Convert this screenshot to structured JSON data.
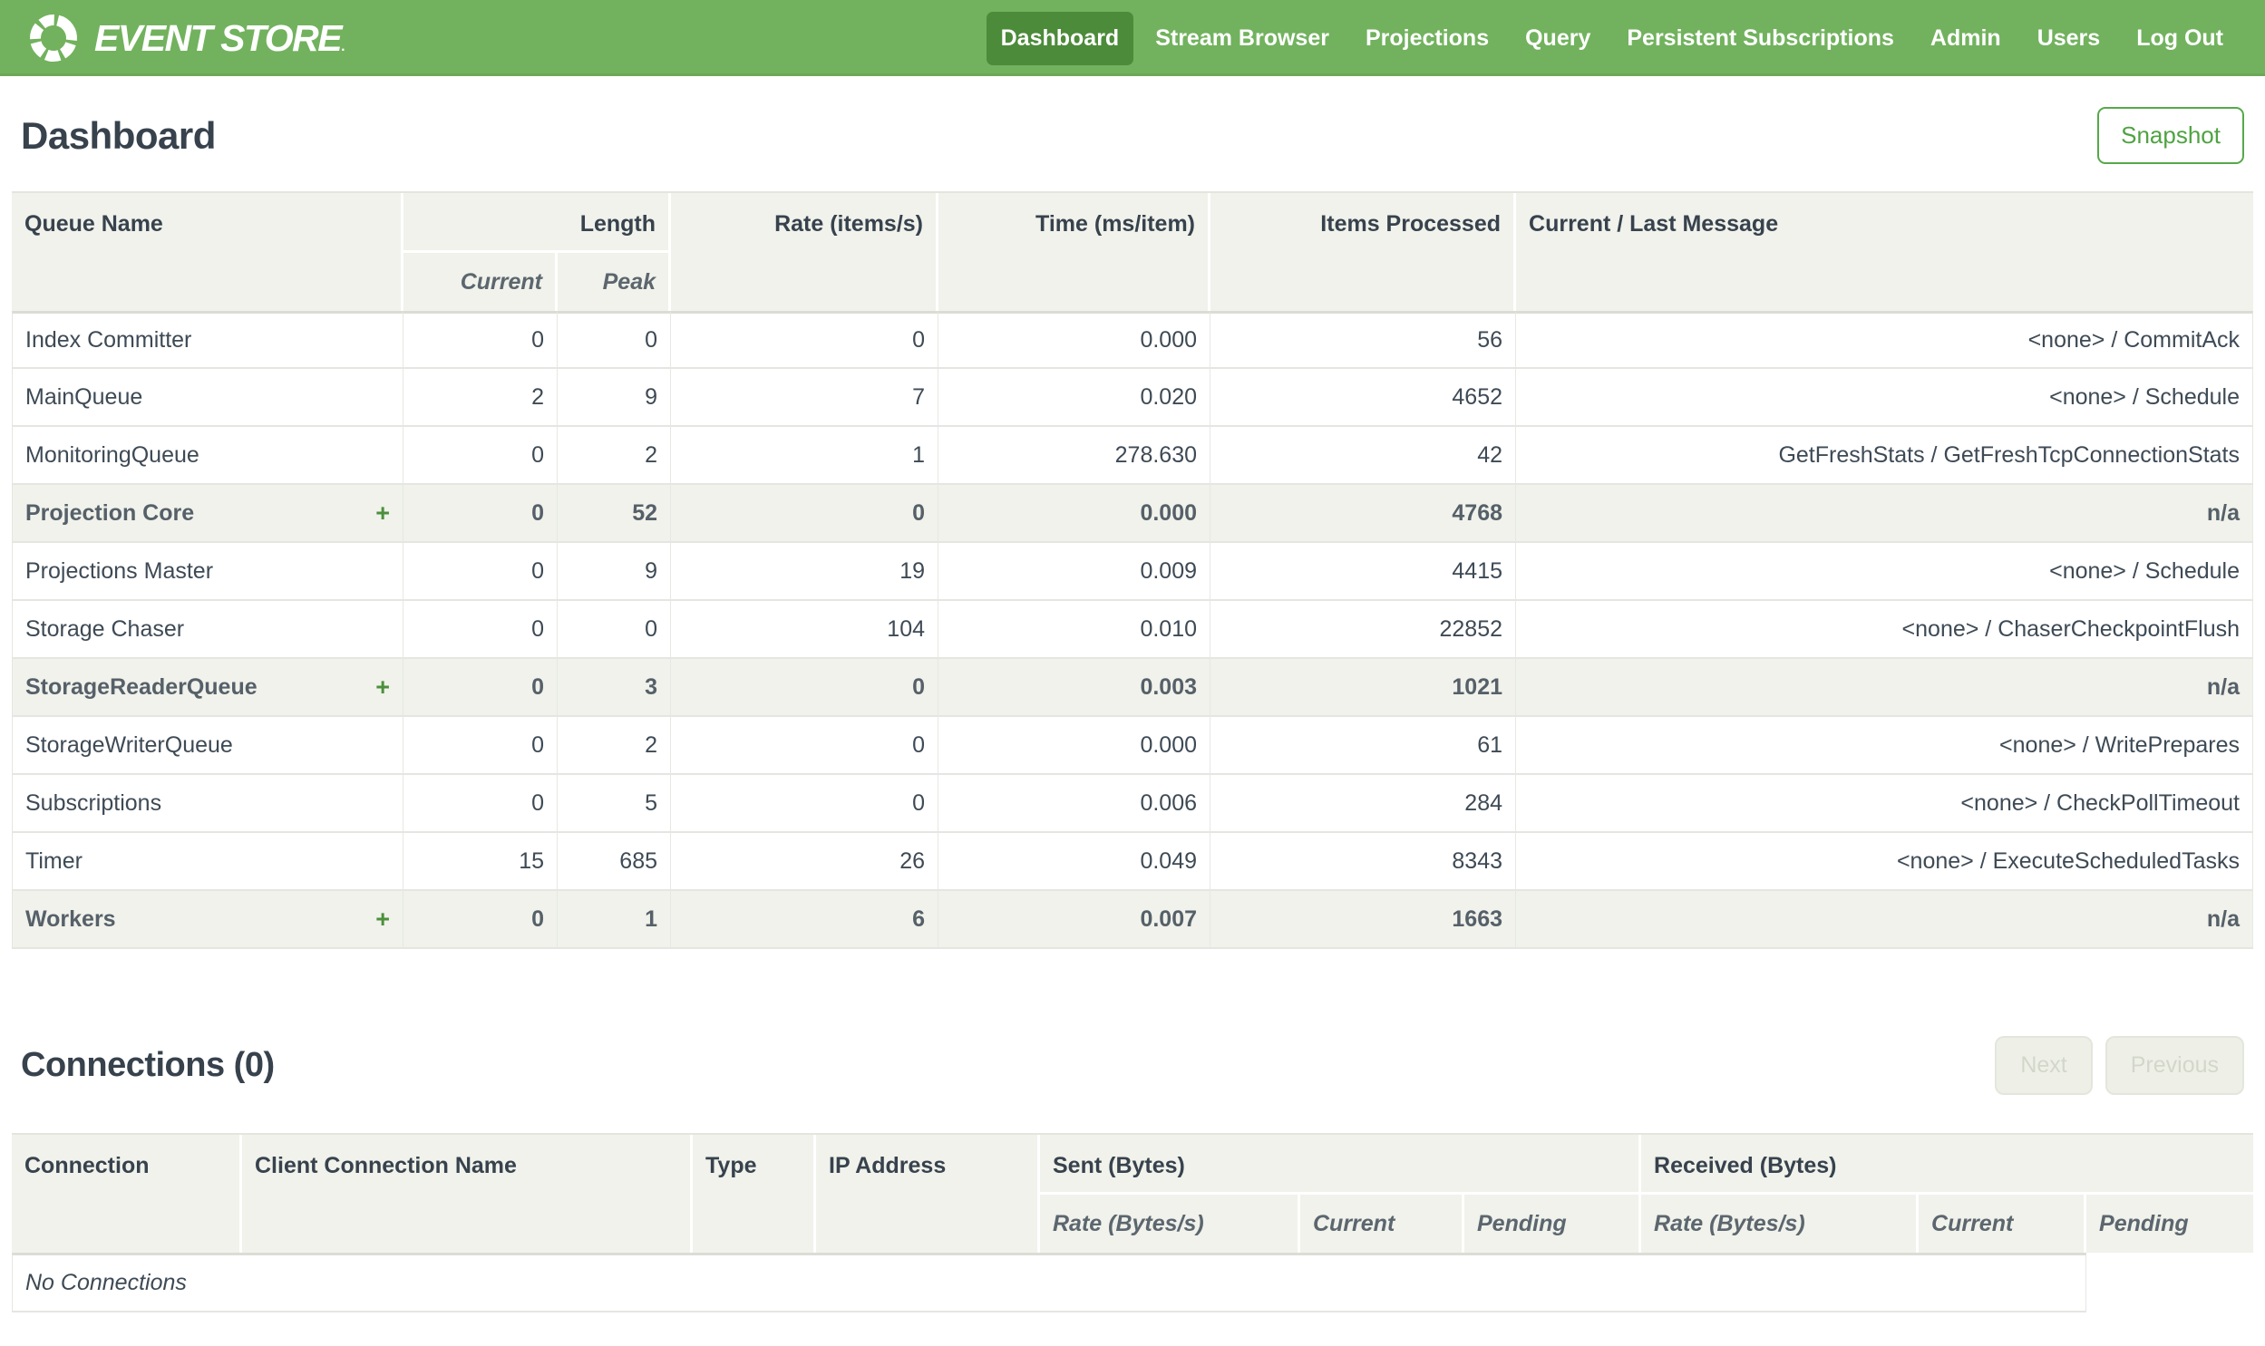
{
  "nav": {
    "brand": "EVENT STORE",
    "brand_mark": ".",
    "items": [
      {
        "label": "Dashboard",
        "active": true
      },
      {
        "label": "Stream Browser",
        "active": false
      },
      {
        "label": "Projections",
        "active": false
      },
      {
        "label": "Query",
        "active": false
      },
      {
        "label": "Persistent Subscriptions",
        "active": false
      },
      {
        "label": "Admin",
        "active": false
      },
      {
        "label": "Users",
        "active": false
      },
      {
        "label": "Log Out",
        "active": false
      }
    ]
  },
  "page": {
    "title": "Dashboard",
    "snapshot_label": "Snapshot"
  },
  "queue_table": {
    "expand_symbol": "+",
    "headers": {
      "queue_name": "Queue Name",
      "length": "Length",
      "current": "Current",
      "peak": "Peak",
      "rate": "Rate (items/s)",
      "time": "Time (ms/item)",
      "items_processed": "Items Processed",
      "message": "Current / Last Message"
    },
    "rows": [
      {
        "name": "Index Committer",
        "group": false,
        "current": "0",
        "peak": "0",
        "rate": "0",
        "time": "0.000",
        "items": "56",
        "message": "<none> / CommitAck"
      },
      {
        "name": "MainQueue",
        "group": false,
        "current": "2",
        "peak": "9",
        "rate": "7",
        "time": "0.020",
        "items": "4652",
        "message": "<none> / Schedule"
      },
      {
        "name": "MonitoringQueue",
        "group": false,
        "current": "0",
        "peak": "2",
        "rate": "1",
        "time": "278.630",
        "items": "42",
        "message": "GetFreshStats / GetFreshTcpConnectionStats"
      },
      {
        "name": "Projection Core",
        "group": true,
        "current": "0",
        "peak": "52",
        "rate": "0",
        "time": "0.000",
        "items": "4768",
        "message": "n/a"
      },
      {
        "name": "Projections Master",
        "group": false,
        "current": "0",
        "peak": "9",
        "rate": "19",
        "time": "0.009",
        "items": "4415",
        "message": "<none> / Schedule"
      },
      {
        "name": "Storage Chaser",
        "group": false,
        "current": "0",
        "peak": "0",
        "rate": "104",
        "time": "0.010",
        "items": "22852",
        "message": "<none> / ChaserCheckpointFlush"
      },
      {
        "name": "StorageReaderQueue",
        "group": true,
        "current": "0",
        "peak": "3",
        "rate": "0",
        "time": "0.003",
        "items": "1021",
        "message": "n/a"
      },
      {
        "name": "StorageWriterQueue",
        "group": false,
        "current": "0",
        "peak": "2",
        "rate": "0",
        "time": "0.000",
        "items": "61",
        "message": "<none> / WritePrepares"
      },
      {
        "name": "Subscriptions",
        "group": false,
        "current": "0",
        "peak": "5",
        "rate": "0",
        "time": "0.006",
        "items": "284",
        "message": "<none> / CheckPollTimeout"
      },
      {
        "name": "Timer",
        "group": false,
        "current": "15",
        "peak": "685",
        "rate": "26",
        "time": "0.049",
        "items": "8343",
        "message": "<none> / ExecuteScheduledTasks"
      },
      {
        "name": "Workers",
        "group": true,
        "current": "0",
        "peak": "1",
        "rate": "6",
        "time": "0.007",
        "items": "1663",
        "message": "n/a"
      }
    ]
  },
  "connections": {
    "title": "Connections (0)",
    "next_label": "Next",
    "previous_label": "Previous",
    "headers": {
      "connection": "Connection",
      "client_name": "Client Connection Name",
      "type": "Type",
      "ip": "IP Address",
      "sent": "Sent (Bytes)",
      "received": "Received (Bytes)",
      "rate": "Rate (Bytes/s)",
      "current": "Current",
      "pending": "Pending"
    },
    "empty_message": "No Connections"
  },
  "colors": {
    "nav_green": "#72b25e",
    "nav_active_green": "#4c8b3a",
    "accent_green": "#4fa342",
    "header_bg": "#f0f2eb",
    "text_dark": "#37424d"
  }
}
